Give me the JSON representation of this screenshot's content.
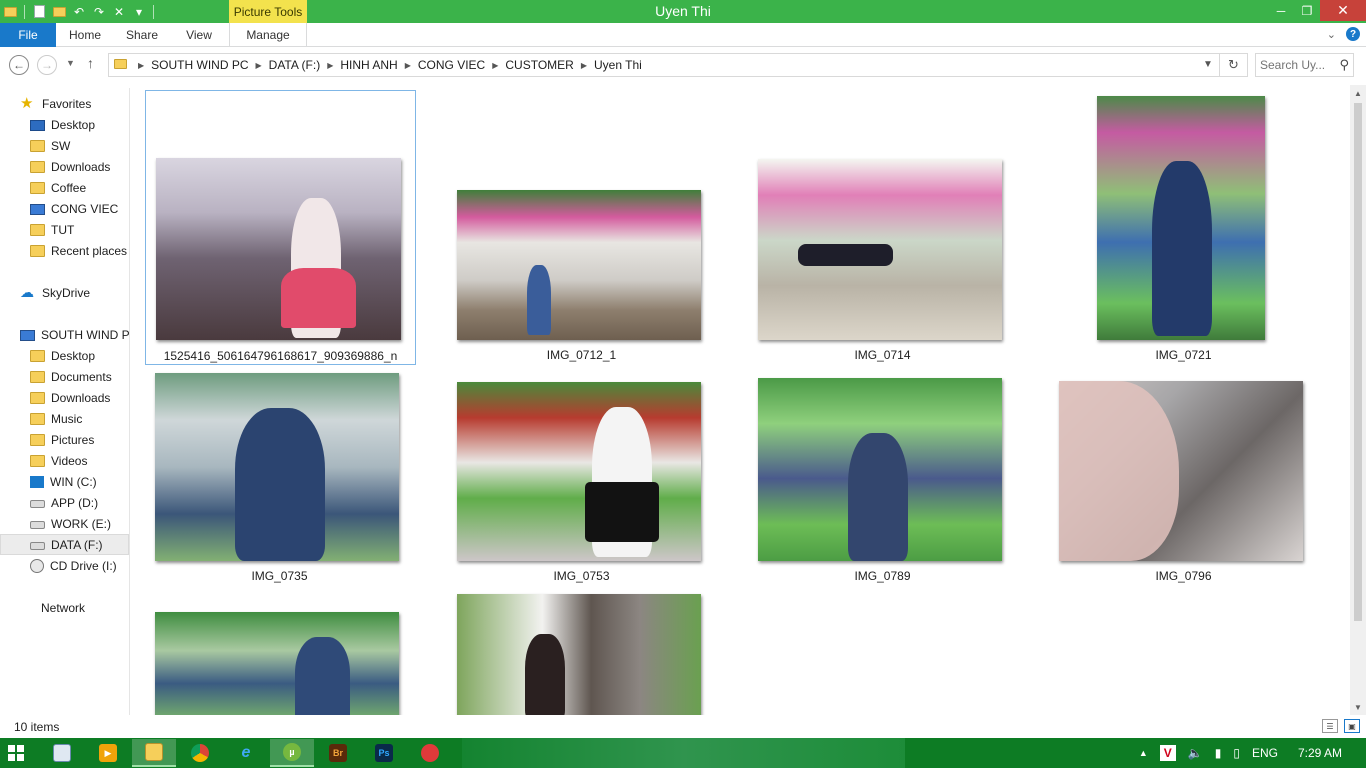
{
  "window": {
    "title": "Uyen Thi",
    "context_tab": "Picture Tools",
    "controls": {
      "minimize": "─",
      "maximize": "❐",
      "close": "✕"
    }
  },
  "ribbon": {
    "tabs": {
      "file": "File",
      "home": "Home",
      "share": "Share",
      "view": "View",
      "manage": "Manage"
    },
    "collapse_glyph": "⌄",
    "help_glyph": "?"
  },
  "navbar": {
    "back": "←",
    "forward": "→",
    "recent": "▼",
    "up": "↑",
    "breadcrumbs": [
      "SOUTH WIND PC",
      "DATA (F:)",
      "HINH ANH",
      "CONG VIEC",
      "CUSTOMER",
      "Uyen Thi"
    ],
    "crumb_sep": "▶",
    "address_dropdown": "▼",
    "refresh": "↻",
    "search_placeholder": "Search Uy...",
    "search_icon": "⚲"
  },
  "navpane": {
    "favorites": "Favorites",
    "fav_items": [
      "Desktop",
      "SW",
      "Downloads",
      "Coffee",
      "CONG VIEC",
      "TUT",
      "Recent places"
    ],
    "skydrive": "SkyDrive",
    "this_pc": "SOUTH WIND PC",
    "pc_items": [
      "Desktop",
      "Documents",
      "Downloads",
      "Music",
      "Pictures",
      "Videos",
      "WIN (C:)",
      "APP (D:)",
      "WORK (E:)",
      "DATA (F:)",
      "CD Drive (I:)"
    ],
    "network": "Network"
  },
  "files": [
    {
      "name": "1525416_506164796168617_909369886_n",
      "selected": true
    },
    {
      "name": "IMG_0712_1"
    },
    {
      "name": "IMG_0714"
    },
    {
      "name": "IMG_0721"
    },
    {
      "name": "IMG_0735"
    },
    {
      "name": "IMG_0753"
    },
    {
      "name": "IMG_0789"
    },
    {
      "name": "IMG_0796"
    },
    {
      "name": ""
    },
    {
      "name": ""
    }
  ],
  "scroll": {
    "up": "▲",
    "down": "▼"
  },
  "status": {
    "count": "10 items"
  },
  "taskbar": {
    "apps": [
      "explorer-doc",
      "media",
      "file-explorer",
      "chrome",
      "ie",
      "utorrent",
      "bridge",
      "photoshop",
      "paint"
    ],
    "bridge_label": "Br",
    "ps_label": "Ps",
    "tray": {
      "expand": "▲",
      "lang": "ENG",
      "time": "7:29 AM",
      "v_label": "V"
    }
  },
  "colors": {
    "titlebar": "#3bb34a",
    "picture_tools": "#f3e24d",
    "file_tab": "#1979ca",
    "close": "#c7423a",
    "taskbar": "#0d7c24",
    "selection": "#7fb6e6"
  }
}
